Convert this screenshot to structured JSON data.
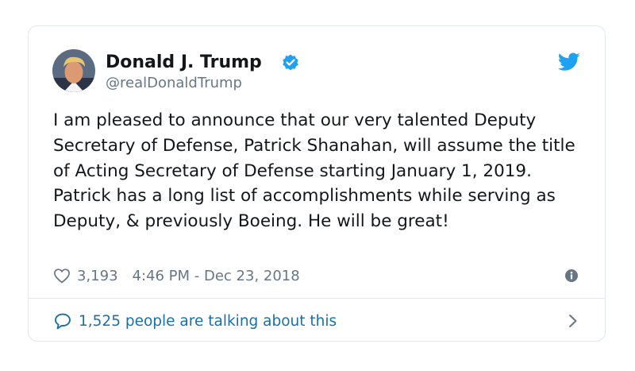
{
  "tweet": {
    "author_name": "Donald J. Trump",
    "handle": "@realDonaldTrump",
    "text": "I am pleased to announce that our very talented Deputy Secretary of Defense, Patrick Shanahan, will assume the title of Acting Secretary of Defense starting January 1, 2019. Patrick has a long list of accomplishments while serving as Deputy, & previously Boeing. He will be great!",
    "likes": "3,193",
    "timestamp": "4:46 PM - Dec 23, 2018",
    "talking": "1,525 people are talking about this"
  },
  "icons": {
    "verified": "verified-badge-icon",
    "brand": "twitter-bird-icon",
    "like": "heart-icon",
    "info": "info-icon",
    "reply": "speech-bubble-icon",
    "chevron": "chevron-right-icon"
  },
  "colors": {
    "brand_blue": "#1da1f2",
    "link_blue": "#1b6fa8",
    "text": "#14171a",
    "muted": "#657786",
    "border": "#e1e8ed"
  }
}
